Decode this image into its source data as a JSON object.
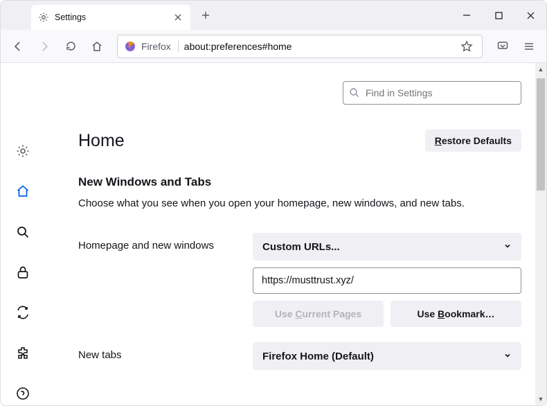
{
  "tab": {
    "title": "Settings"
  },
  "urlbar": {
    "identity": "Firefox",
    "url": "about:preferences#home"
  },
  "search": {
    "placeholder": "Find in Settings"
  },
  "page": {
    "title": "Home",
    "restore_label": "Restore Defaults",
    "section_title": "New Windows and Tabs",
    "section_desc": "Choose what you see when you open your homepage, new windows, and new tabs."
  },
  "form": {
    "homepage_label": "Homepage and new windows",
    "homepage_select": "Custom URLs...",
    "homepage_value": "https://musttrust.xyz/",
    "use_current": "Use Current Pages",
    "use_bookmark": "Use Bookmark…",
    "newtabs_label": "New tabs",
    "newtabs_select": "Firefox Home (Default)"
  }
}
